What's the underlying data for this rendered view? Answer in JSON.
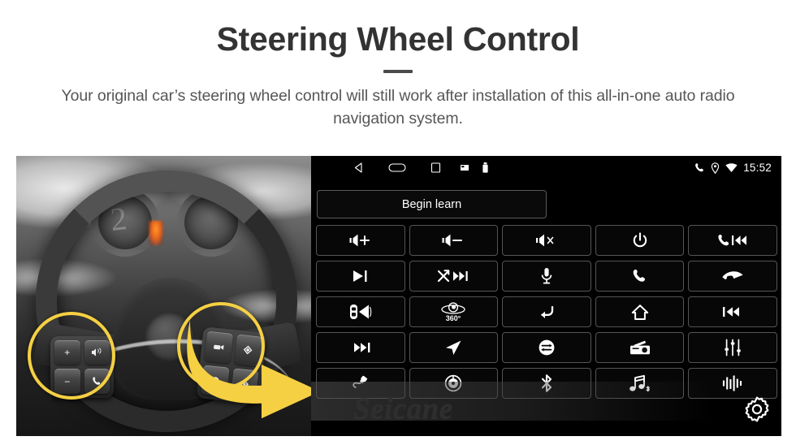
{
  "header": {
    "title": "Steering Wheel Control",
    "subtitle": "Your original car’s steering wheel control will still work after installation of this all-in-one auto radio navigation system."
  },
  "photo": {
    "alt_name": "steering-wheel-photo",
    "highlight_color": "#F5D043",
    "arrow_color": "#F5D043",
    "left_cluster_keys": [
      "volume-up",
      "voice-command",
      "volume-down",
      "phone-call"
    ],
    "right_cluster_keys": [
      "media-source",
      "cursor-up",
      "mode-circle",
      "cursor-down"
    ]
  },
  "head_unit": {
    "statusbar": {
      "nav_icons": [
        "back-icon",
        "home-icon",
        "recents-icon"
      ],
      "system_icons": [
        "sdcard-icon",
        "usb-icon"
      ],
      "right_icons": [
        "phone-icon",
        "location-icon",
        "wifi-icon"
      ],
      "clock": "15:52"
    },
    "learn_button": "Begin learn",
    "watermark": "Seicane",
    "settings_icon": "gear-icon",
    "grid": [
      [
        {
          "name": "volume-up-button",
          "icon": "volume-plus"
        },
        {
          "name": "volume-down-button",
          "icon": "volume-minus"
        },
        {
          "name": "mute-button",
          "icon": "volume-mute"
        },
        {
          "name": "power-button",
          "icon": "power"
        },
        {
          "name": "phone-previous-button",
          "icon": "phone-prev"
        }
      ],
      [
        {
          "name": "play-pause-button",
          "icon": "play-pause"
        },
        {
          "name": "shuffle-next-button",
          "icon": "shuffle-next"
        },
        {
          "name": "voice-mic-button",
          "icon": "microphone"
        },
        {
          "name": "answer-call-button",
          "icon": "phone-answer"
        },
        {
          "name": "end-call-button",
          "icon": "phone-hangup"
        }
      ],
      [
        {
          "name": "parking-sensor-button",
          "icon": "car-speaker"
        },
        {
          "name": "camera-360-button",
          "icon": "camera-360",
          "label": "360°"
        },
        {
          "name": "back-button",
          "icon": "back-arrow"
        },
        {
          "name": "home-button",
          "icon": "home"
        },
        {
          "name": "previous-track-button",
          "icon": "previous-track"
        }
      ],
      [
        {
          "name": "next-track-button",
          "icon": "next-track"
        },
        {
          "name": "navigation-button",
          "icon": "navigation-arrow"
        },
        {
          "name": "source-switch-button",
          "icon": "source-swap"
        },
        {
          "name": "radio-button",
          "icon": "radio"
        },
        {
          "name": "equalizer-button",
          "icon": "equalizer"
        }
      ],
      [
        {
          "name": "usb-aux-button",
          "icon": "cable"
        },
        {
          "name": "disc-button",
          "icon": "disc"
        },
        {
          "name": "bluetooth-button",
          "icon": "bluetooth"
        },
        {
          "name": "bluetooth-music-button",
          "icon": "music-bluetooth"
        },
        {
          "name": "voice-assistant-button",
          "icon": "waveform"
        }
      ]
    ]
  }
}
